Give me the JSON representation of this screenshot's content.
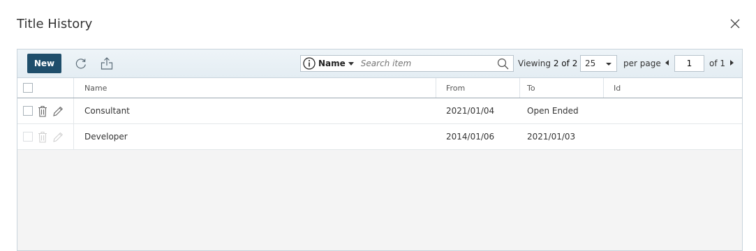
{
  "dialog": {
    "title": "Title History"
  },
  "toolbar": {
    "new_label": "New",
    "search": {
      "field": "Name",
      "placeholder": "Search item"
    },
    "viewing_prefix": "Viewing ",
    "viewing_count": "2 of 2",
    "per_page_value": "25",
    "per_page_label": "per page",
    "page_number": "1",
    "of_pages": "of 1"
  },
  "table": {
    "columns": [
      "Name",
      "From",
      "To",
      "Id"
    ],
    "rows": [
      {
        "name": "Consultant",
        "from": "2021/01/04",
        "to": "Open Ended",
        "id": ""
      },
      {
        "name": "Developer",
        "from": "2014/01/06",
        "to": "2021/01/03",
        "id": ""
      }
    ]
  },
  "colors": {
    "primary_button": "#1f4e6b",
    "toolbar_bg": "#e4edf3",
    "grid_border": "#c9d4dc"
  },
  "icons": [
    "close-icon",
    "refresh-icon",
    "export-icon",
    "info-icon",
    "search-icon",
    "trash-icon",
    "pencil-icon"
  ]
}
